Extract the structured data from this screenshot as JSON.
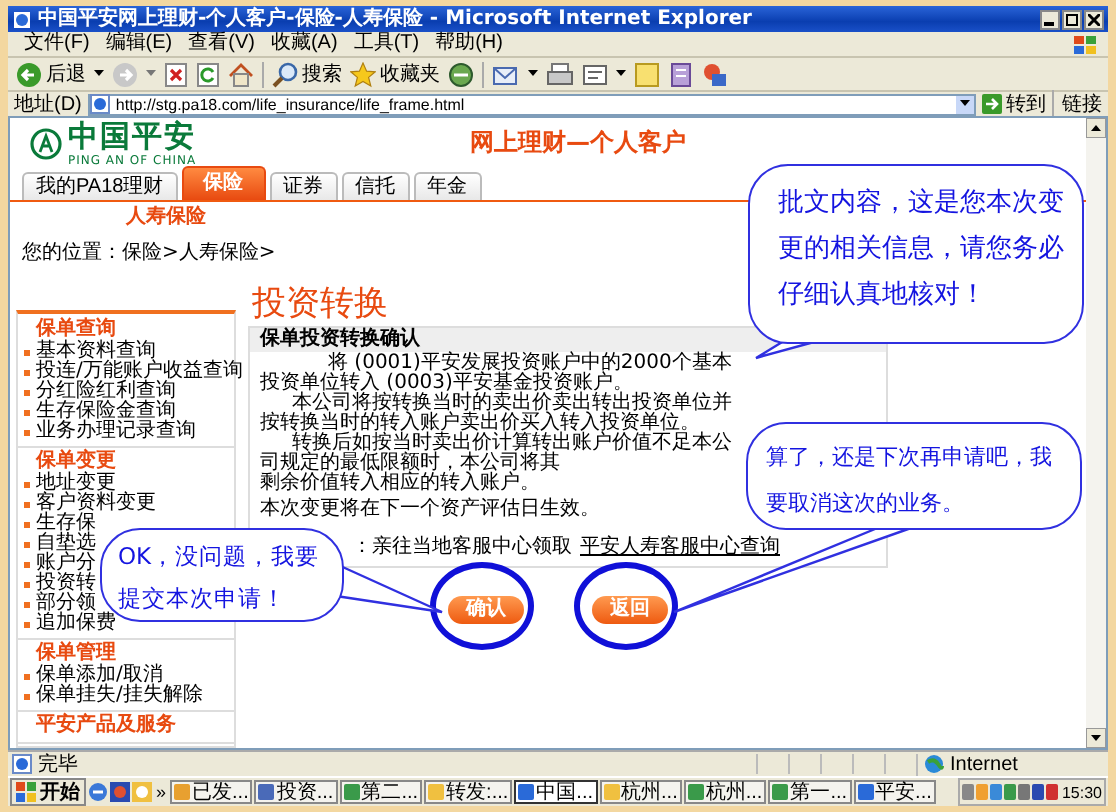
{
  "window": {
    "title": "中国平安网上理财-个人客户-保险-人寿保险 - Microsoft Internet Explorer"
  },
  "menu": [
    "文件(F)",
    "编辑(E)",
    "查看(V)",
    "收藏(A)",
    "工具(T)",
    "帮助(H)"
  ],
  "toolbar": {
    "back": "后退",
    "search": "搜索",
    "favorites": "收藏夹"
  },
  "address": {
    "label": "地址(D)",
    "url": "http://stg.pa18.com/life_insurance/life_frame.html",
    "go": "转到",
    "links": "链接"
  },
  "site": {
    "logo_cn": "中国平安",
    "logo_en": "PING AN OF CHINA",
    "title": "网上理财—个人客户"
  },
  "tabs": [
    {
      "label": "我的PA18理财",
      "selected": false
    },
    {
      "label": "保险",
      "selected": true
    },
    {
      "label": "证券",
      "selected": false
    },
    {
      "label": "信托",
      "selected": false
    },
    {
      "label": "年金",
      "selected": false
    }
  ],
  "subtab": "人寿保险",
  "breadcrumb": "您的位置：保险>人寿保险>",
  "sidebar": [
    {
      "title": "保单查询",
      "items": [
        "基本资料查询",
        "投连/万能账户收益查询",
        "分红险红利查询",
        "生存保险金查询",
        "业务办理记录查询"
      ]
    },
    {
      "title": "保单变更",
      "items": [
        "地址变更",
        "客户资料变更",
        "生存保",
        "自垫选",
        "账户分",
        "投资转",
        "部分领",
        "追加保费"
      ]
    },
    {
      "title": "保单管理",
      "items": [
        "保单添加/取消",
        "保单挂失/挂失解除"
      ]
    },
    {
      "title": "平安产品及服务"
    }
  ],
  "page_title": "投资转换",
  "panel": {
    "title": "保单投资转换确认",
    "paragraphs": [
      "将 (0001)平安发展投资账户中的2000个基本投资单位转入 (0003)平安基金投资账户。",
      "本公司将按转换当时的卖出价卖出转出投资单位并按转换当时的转入账户卖出价买入转入投资单位。",
      "转换后如按当时卖出价计算转出账户价值不足本公司规定的最低限额时，本公司将其",
      "剩余价值转入相应的转入账户。",
      "本次变更将在下一个资产评估日生效。"
    ],
    "pickup": "：亲往当地客服中心领取",
    "link": "平安人寿客服中心查询"
  },
  "buttons": [
    {
      "label": "确认",
      "circled": true
    },
    {
      "label": "返回",
      "circled": true
    }
  ],
  "callouts": [
    {
      "text": "批文内容，这是您本次变更的相关信息，请您务必仔细认真地核对！"
    },
    {
      "text": "算了，还是下次再申请吧，我要取消这次的业务。"
    },
    {
      "text": "OK，没问题，我要提交本次申请！"
    }
  ],
  "status_bar": {
    "text": "完毕",
    "zone": "Internet"
  },
  "taskbar": {
    "start": "开始",
    "more": "»",
    "tasks": [
      {
        "label": "已发...",
        "selected": false
      },
      {
        "label": "投资...",
        "selected": false
      },
      {
        "label": "第二...",
        "selected": false
      },
      {
        "label": "转发:...",
        "selected": false
      },
      {
        "label": "中国...",
        "selected": true
      },
      {
        "label": "杭州...",
        "selected": false
      },
      {
        "label": "杭州...",
        "selected": false
      },
      {
        "label": "第一...",
        "selected": false
      },
      {
        "label": "平安...",
        "selected": false
      }
    ],
    "clock": "15:30"
  }
}
